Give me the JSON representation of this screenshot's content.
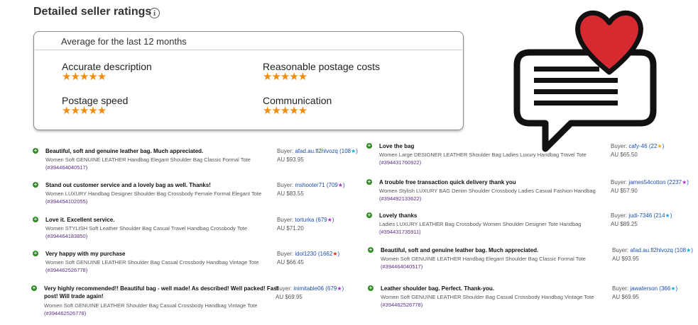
{
  "title": "Detailed seller ratings",
  "info_icon": "info-icon",
  "ratings": {
    "header": "Average for the last 12 months",
    "metrics": [
      {
        "label": "Accurate description",
        "stars": 5
      },
      {
        "label": "Reasonable postage costs",
        "stars": 5
      },
      {
        "label": "Postage speed",
        "stars": 5
      },
      {
        "label": "Communication",
        "stars": 5
      }
    ],
    "star_color": "#f28c0f"
  },
  "feedback_left": [
    {
      "comment": "Beautiful, soft and genuine leather bag. Much appreciated.",
      "item": "Women Soft GENUINE LEATHER Handbag Elegant Shoulder Bag Classic Formal Tote",
      "item_number": "(#394464040517)",
      "buyer_prefix": "Buyer:",
      "buyer": "afad.au.fl2hlvozq",
      "count_open": "(",
      "count": "108",
      "star": "★",
      "count_close": ")",
      "price": "AU $93.95"
    },
    {
      "comment": "Stand out customer service and a lovely bag as well. Thanks!",
      "item": "Women LUXURY Handbag Designer Shoulder Bag Crossbody Female Formal Elegant Tote",
      "item_number": "(#394454102055)",
      "buyer_prefix": "Buyer:",
      "buyer": "mshooter71",
      "count_open": "(",
      "count": "709",
      "star": "★",
      "count_close": ")",
      "price": "AU $83.55"
    },
    {
      "comment": "Love it. Excellent service.",
      "item": "Women STYLISH Soft Leather Shoulder Bag Casual Travel Handbag Crossbody Tote",
      "item_number": "(#394464183850)",
      "buyer_prefix": "Buyer:",
      "buyer": "torturka",
      "count_open": "(",
      "count": "679",
      "star": "★",
      "count_close": ")",
      "price": "AU $71.20"
    },
    {
      "comment": "Very happy with my purchase",
      "item": "Women Soft GENUINE LEATHER Shoulder Bag Casual Crossbody Handbag Vintage Tote",
      "item_number": "(#394462526778)",
      "buyer_prefix": "Buyer:",
      "buyer": "idol1230",
      "count_open": "(",
      "count": "1662",
      "star": "★",
      "count_close": ")",
      "price": "AU $66.45"
    },
    {
      "comment": "Very highly recommended!! Beautiful bag - well made! As described! Well packed! Fast post! Will trade again!",
      "item": "Women Soft GENUINE LEATHER Shoulder Bag Casual Crossbody Handbag Vintage Tote",
      "item_number": "(#394462526778)",
      "buyer_prefix": "Buyer:",
      "buyer": "inimitable06",
      "count_open": "(",
      "count": "679",
      "star": "★",
      "count_close": ")",
      "price": "AU $69.95"
    }
  ],
  "feedback_right": [
    {
      "comment": "Love the bag",
      "item": "Women Large DESIGNER LEATHER Shoulder Bag Ladies Luxury Handbag Travel Tote",
      "item_number": "(#394431760922)",
      "buyer_prefix": "Buyer:",
      "buyer": "cafy-46",
      "count_open": "(",
      "count": "22",
      "star": "★",
      "count_close": ")",
      "price": "AU $65.50"
    },
    {
      "comment": "A trouble free transaction quick delivery thank you",
      "item": "Women Stylish LUXURY BAG Denim Shoulder Crossbody Ladies Casual Fashion Handbag",
      "item_number": "(#394492133622)",
      "buyer_prefix": "Buyer:",
      "buyer": "james54cotton",
      "count_open": "(",
      "count": "2237",
      "star": "★",
      "count_close": ")",
      "price": "AU $57.90"
    },
    {
      "comment": "Lovely thanks",
      "item": "Ladies LUXURY LEATHER Bag Crossbody Women Shoulder Designer Tote Handbag",
      "item_number": "(#394431735911)",
      "buyer_prefix": "Buyer:",
      "buyer": "judi-7346",
      "count_open": "(",
      "count": "214",
      "star": "★",
      "count_close": ")",
      "price": "AU $89.25"
    },
    {
      "comment": "Beautiful, soft and genuine leather bag. Much appreciated.",
      "item": "Women Soft GENUINE LEATHER Handbag Elegant Shoulder Bag Classic Formal Tote",
      "item_number": "(#394464040517)",
      "buyer_prefix": "Buyer:",
      "buyer": "afad.au.fl2hlvozq",
      "count_open": "(",
      "count": "108",
      "star": "★",
      "count_close": ")",
      "price": "AU $93.95"
    },
    {
      "comment": "Leather shoulder bag. Perfect. Thank-you.",
      "item": "Women Soft GENUINE LEATHER Shoulder Bag Casual Crossbody Handbag Vintage Tote",
      "item_number": "(#394462526778)",
      "buyer_prefix": "Buyer:",
      "buyer": "jawaterson",
      "count_open": "(",
      "count": "366",
      "star": "★",
      "count_close": ")",
      "price": "AU $69.95"
    }
  ],
  "star_colors": {
    "turquoise": "#1aa8d8",
    "purple": "#b02cc7",
    "yellow": "#f2a900",
    "red": "#d8262b",
    "orange": "#f28c0f"
  },
  "logo": {
    "heart_color": "#d62930",
    "bubble_color": "#111111",
    "icon": "speech-bubble-heart-icon"
  }
}
